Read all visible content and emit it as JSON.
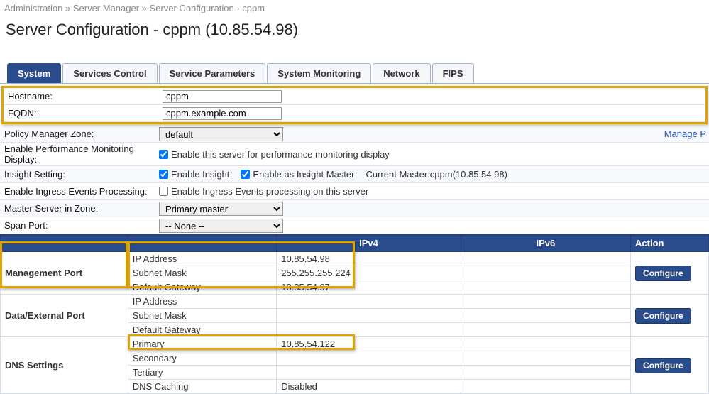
{
  "breadcrumb": {
    "a": "Administration",
    "b": "Server Manager",
    "c": "Server Configuration - cppm"
  },
  "page_title": "Server Configuration - cppm (10.85.54.98)",
  "tabs": [
    "System",
    "Services Control",
    "Service Parameters",
    "System Monitoring",
    "Network",
    "FIPS"
  ],
  "labels": {
    "hostname": "Hostname:",
    "fqdn": "FQDN:",
    "pmzone": "Policy Manager Zone:",
    "perf": "Enable Performance Monitoring Display:",
    "insight": "Insight Setting:",
    "ingress": "Enable Ingress Events Processing:",
    "master": "Master Server in Zone:",
    "span": "Span Port:"
  },
  "values": {
    "hostname": "cppm",
    "fqdn": "cppm.example.com",
    "pmzone": "default",
    "master": "Primary master",
    "span": "-- None --",
    "perf_txt": "Enable this server for performance monitoring display",
    "insight_enable": "Enable Insight",
    "insight_master": "Enable as Insight Master",
    "insight_current": "Current Master:cppm(10.85.54.98)",
    "ingress_txt": "Enable Ingress Events processing on this server",
    "manage_link": "Manage P"
  },
  "grid": {
    "headers": {
      "blank1": "",
      "blank2": "",
      "ipv4": "IPv4",
      "ipv6": "IPv6",
      "action": "Action"
    },
    "mgmt": {
      "label": "Management Port",
      "ip_lbl": "IP Address",
      "ip_v4": "10.85.54.98",
      "sm_lbl": "Subnet Mask",
      "sm_v4": "255.255.255.224",
      "gw_lbl": "Default Gateway",
      "gw_v4": "10.85.54.97"
    },
    "ext": {
      "label": "Data/External Port",
      "ip_lbl": "IP Address",
      "sm_lbl": "Subnet Mask",
      "gw_lbl": "Default Gateway"
    },
    "dns": {
      "label": "DNS Settings",
      "pri_lbl": "Primary",
      "pri_v4": "10.85.54.122",
      "sec_lbl": "Secondary",
      "ter_lbl": "Tertiary",
      "cache_lbl": "DNS Caching",
      "cache_v4": "Disabled"
    },
    "configure": "Configure"
  }
}
